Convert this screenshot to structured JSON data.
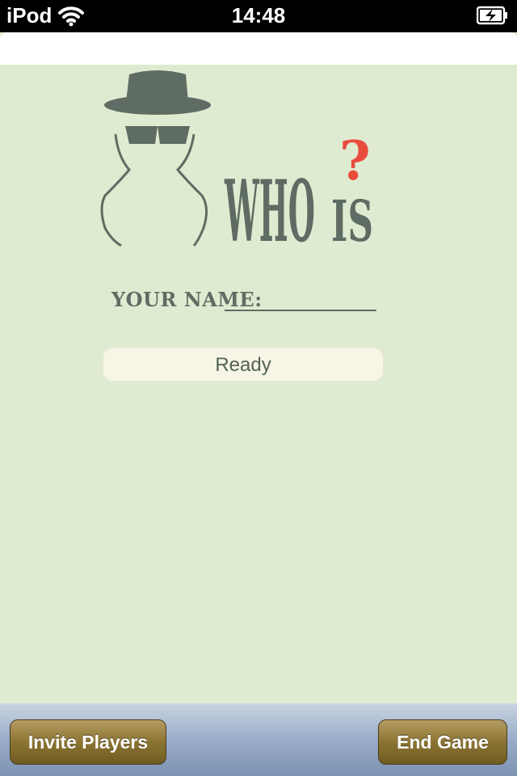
{
  "status_bar": {
    "carrier": "iPod",
    "time": "14:48"
  },
  "logo": {
    "word_who": "WHO",
    "word_is": "IS",
    "question_mark": "?",
    "icon_name": "spy-silhouette-icon"
  },
  "name_form": {
    "label": "YOUR NAME:",
    "value": ""
  },
  "ready_button": {
    "label": "Ready"
  },
  "toolbar": {
    "invite_label": "Invite Players",
    "end_label": "End Game"
  },
  "colors": {
    "background": "#dfebd1",
    "logo": "#5f6c63",
    "accent_question": "#e84c3d",
    "toolbar_button": "#8b7433"
  }
}
